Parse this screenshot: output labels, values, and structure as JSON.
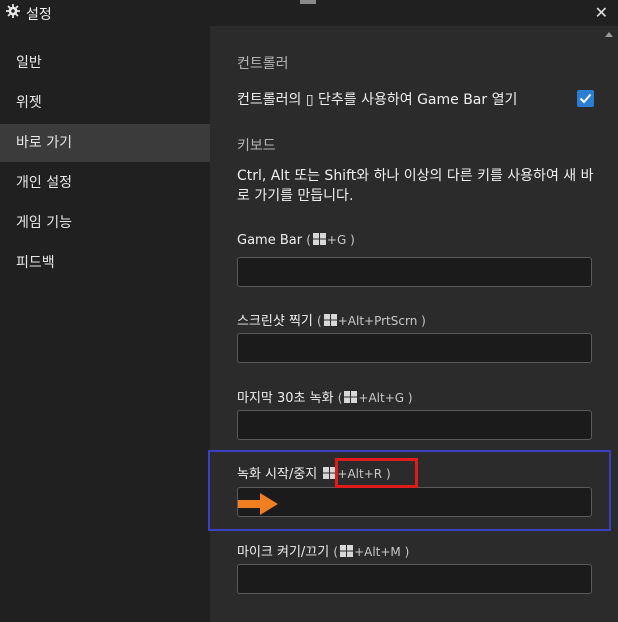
{
  "window": {
    "title": "설정",
    "close_glyph": "✕"
  },
  "sidebar": {
    "items": [
      {
        "label": "일반"
      },
      {
        "label": "위젯"
      },
      {
        "label": "바로 가기",
        "active": true
      },
      {
        "label": "개인 설정"
      },
      {
        "label": "게임 기능"
      },
      {
        "label": "피드백"
      }
    ]
  },
  "controller": {
    "section": "컨트롤러",
    "option_label": "컨트롤러의 ▯ 단추를 사용하여 Game Bar 열기",
    "checked": true
  },
  "keyboard": {
    "section": "키보드",
    "description": "Ctrl, Alt 또는 Shift와 하나 이상의 다른 키를 사용하여 새 바로 가기를 만듭니다.",
    "shortcuts": [
      {
        "name": "Game Bar",
        "open": "(",
        "keys": "+G",
        "close": ")",
        "value": ""
      },
      {
        "name": "스크린샷 찍기",
        "open": "(",
        "keys": "+Alt+PrtScrn",
        "close": ")",
        "value": ""
      },
      {
        "name": "마지막 30초 녹화",
        "open": "(",
        "keys": "+Alt+G",
        "close": ")",
        "value": ""
      },
      {
        "name": "녹화 시작/중지",
        "open": "",
        "keys": "+Alt+R",
        "close": ")",
        "value": ""
      },
      {
        "name": "마이크 켜기/끄기",
        "open": "(",
        "keys": "+Alt+M",
        "close": ")",
        "value": ""
      }
    ]
  },
  "colors": {
    "accent": "#2a7fd4",
    "highlight_blue": "#3a3fc4",
    "highlight_red": "#e01b1b",
    "arrow": "#f07f22"
  }
}
